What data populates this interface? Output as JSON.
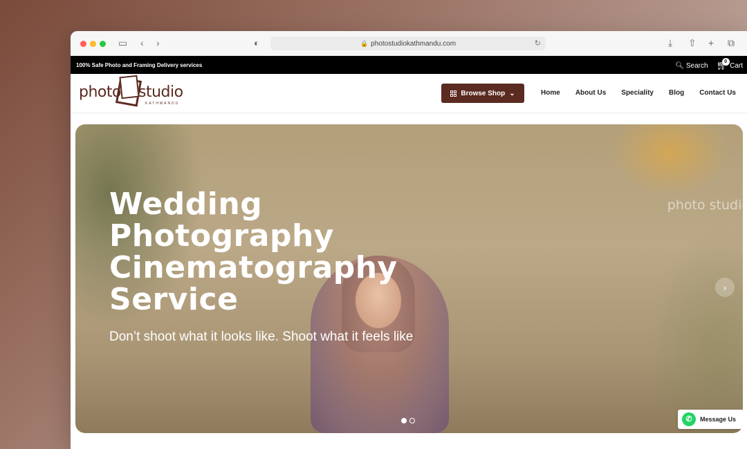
{
  "browser": {
    "url": "photostudiokathmandu.com",
    "icons": [
      "sidebar-icon",
      "back-icon",
      "forward-icon",
      "shield-icon",
      "lock-icon",
      "reload-icon",
      "download-icon",
      "share-icon",
      "new-tab-icon",
      "tabs-icon"
    ]
  },
  "topbar": {
    "promo": "100% Safe Photo and Framing Delivery services",
    "search_label": "Search",
    "cart_label": "Cart",
    "cart_count": "0"
  },
  "header": {
    "logo": {
      "part1": "photo",
      "part2": "studio",
      "sub": "KATHMANDU"
    },
    "browse_label": "Browse Shop",
    "nav": [
      "Home",
      "About Us",
      "Speciality",
      "Blog",
      "Contact Us"
    ]
  },
  "hero": {
    "title": "Wedding\nPhotography\nCinematography\nService",
    "subtitle": "Don’t shoot what it looks like. Shoot what it feels like",
    "watermark": "photo studio",
    "slides": 2,
    "active_slide": 1
  },
  "whatsapp": {
    "label": "Message Us"
  },
  "colors": {
    "brand": "#5b2a20",
    "topbar": "#000000",
    "whatsapp": "#25d366"
  }
}
